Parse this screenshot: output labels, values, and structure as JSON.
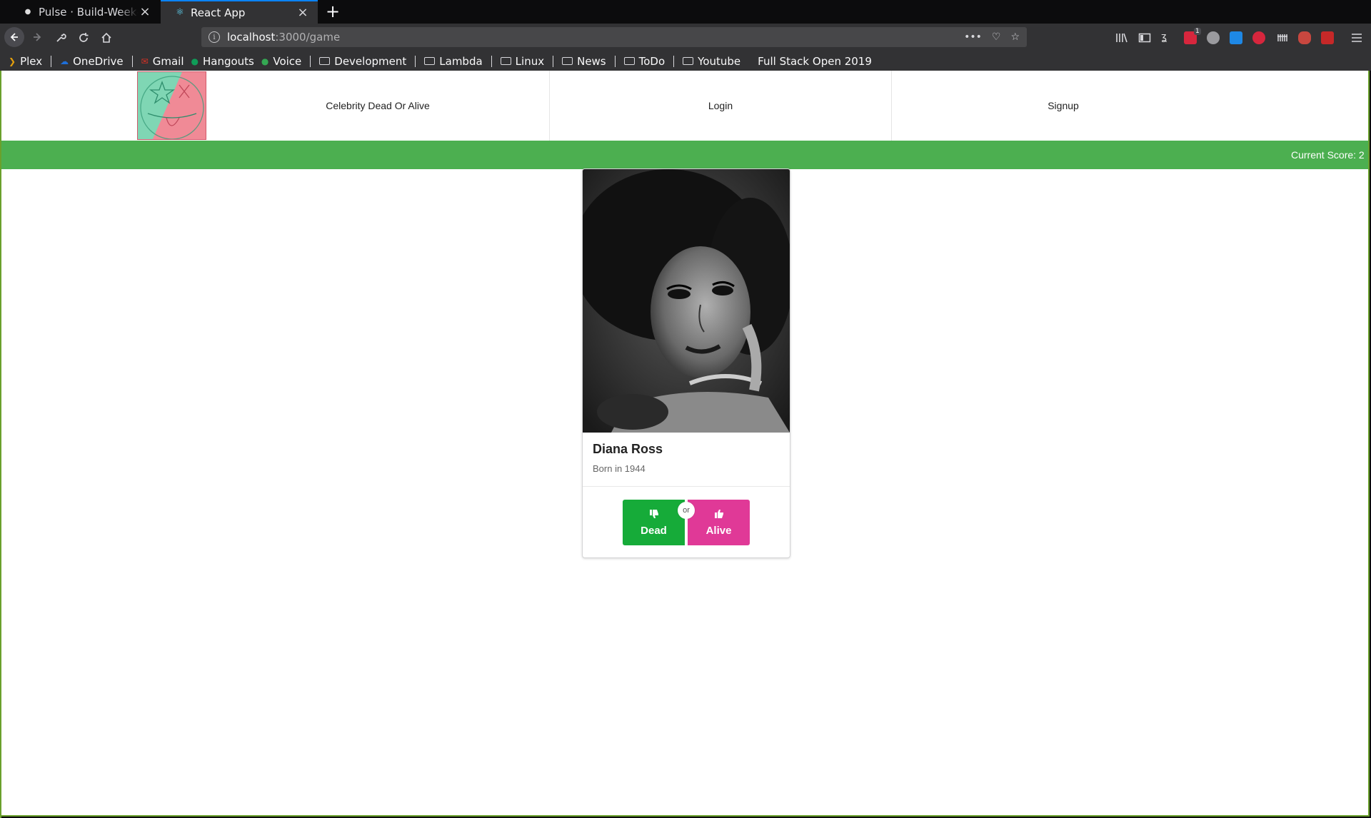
{
  "browser": {
    "tabs": [
      {
        "title": "Pulse · Build-Week-Celebrity-Dead-Or-Alive",
        "active": false
      },
      {
        "title": "React App",
        "active": true
      }
    ],
    "url_host": "localhost",
    "url_path": ":3000/game",
    "bookmarks": [
      {
        "label": "Plex",
        "icon": "plex-icon"
      },
      {
        "label": "OneDrive",
        "icon": "onedrive-icon"
      },
      {
        "label": "Gmail",
        "icon": "gmail-icon"
      },
      {
        "label": "Hangouts",
        "icon": "hangouts-icon"
      },
      {
        "label": "Voice",
        "icon": "voice-icon"
      },
      {
        "label": "Development",
        "icon": "folder-icon"
      },
      {
        "label": "Lambda",
        "icon": "folder-icon"
      },
      {
        "label": "Linux",
        "icon": "folder-icon"
      },
      {
        "label": "News",
        "icon": "folder-icon"
      },
      {
        "label": "ToDo",
        "icon": "folder-icon"
      },
      {
        "label": "Youtube",
        "icon": "folder-icon"
      },
      {
        "label": "Full Stack Open 2019",
        "icon": "bookmark-icon"
      }
    ],
    "notification_count": "1"
  },
  "app": {
    "nav": {
      "title": "Celebrity Dead Or Alive",
      "login": "Login",
      "signup": "Signup"
    },
    "score_label": "Current Score: 2",
    "card": {
      "name": "Diana Ross",
      "meta": "Born in 1944",
      "dead_label": "Dead",
      "alive_label": "Alive",
      "or_label": "or"
    },
    "colors": {
      "score_bar": "#4caf50",
      "dead_button": "#16ab39",
      "alive_button": "#e03997"
    }
  }
}
